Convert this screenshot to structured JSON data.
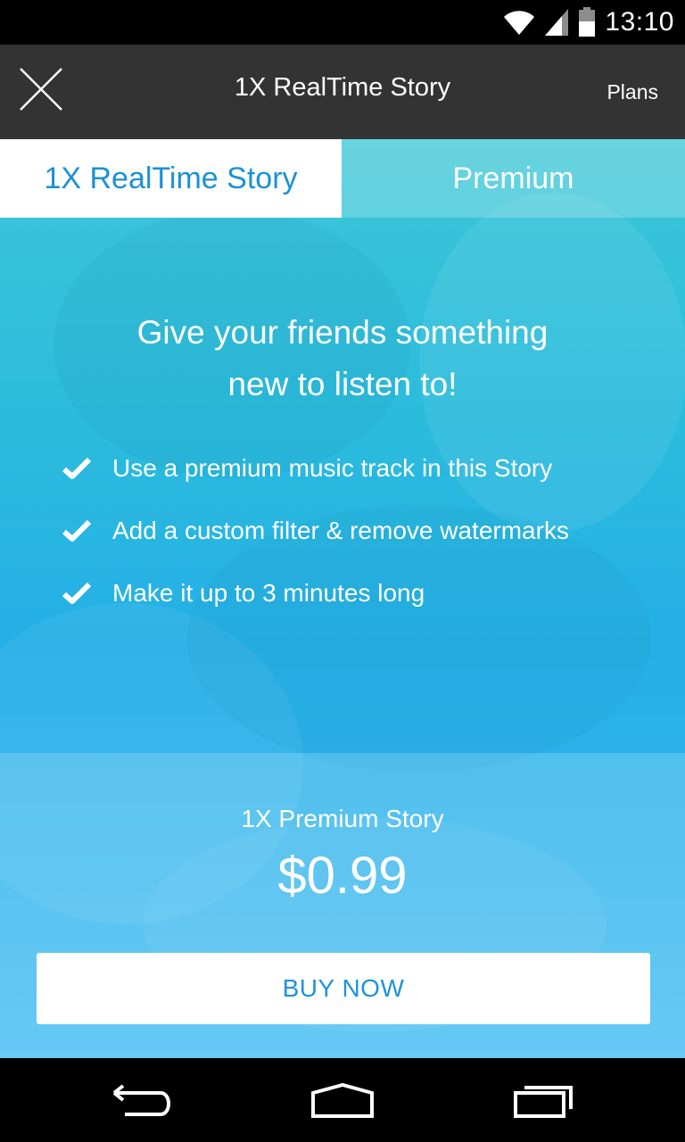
{
  "status_bar": {
    "time": "13:10",
    "icons": [
      "wifi-icon",
      "signal-icon",
      "battery-icon"
    ]
  },
  "app_bar": {
    "title": "1X RealTime Story",
    "plans_label": "Plans",
    "close_icon": "close-icon"
  },
  "tabs": [
    {
      "label": "1X RealTime Story",
      "selected": true
    },
    {
      "label": "Premium",
      "selected": false
    }
  ],
  "headline": {
    "line1": "Give your friends something",
    "line2": "new to listen to!"
  },
  "features": [
    "Use a premium music track in this Story",
    "Add a custom filter & remove watermarks",
    "Make it up to 3 minutes long"
  ],
  "offer": {
    "label": "1X Premium Story",
    "price": "$0.99",
    "button_label": "BUY NOW"
  },
  "nav_bar": {
    "icons": [
      "back-icon",
      "home-icon",
      "recents-icon"
    ]
  },
  "colors": {
    "accent_blue": "#1a91d6",
    "app_bar": "#333333",
    "gradient_top": "#3cc7d7",
    "gradient_bottom": "#45bdf4"
  }
}
